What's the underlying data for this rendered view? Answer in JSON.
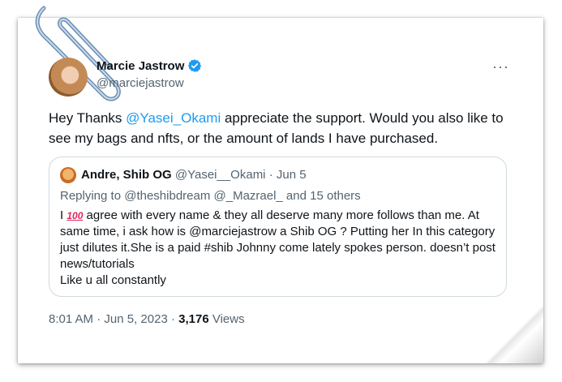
{
  "tweet": {
    "author_name": "Marcie Jastrow",
    "author_handle": "@marciejastrow",
    "more_label": "···",
    "text_before": "Hey Thanks ",
    "mention": "@Yasei_Okami",
    "text_after": " appreciate the support. Would you also like to see my bags and nfts, or the amount of lands I have purchased."
  },
  "quote": {
    "author_name": "Andre, Shib OG",
    "author_handle": "@Yasei__Okami",
    "date_sep": " · ",
    "date": "Jun 5",
    "replying_prefix": "Replying to ",
    "replying_users": "@theshibdream @_Mazrael_",
    "replying_suffix": " and 15 others",
    "text_start": "I ",
    "emoji": "100",
    "text_rest": " agree with every name & they all deserve many more follows than me. At same time, i ask how is @marciejastrow a Shib OG ? Putting her In this category just dilutes it.She is a paid #shib Johnny come lately spokes person. doesn’t post news/tutorials",
    "text_last": "Like u all constantly"
  },
  "footer": {
    "time": "8:01 AM",
    "sep1": " · ",
    "date": "Jun 5, 2023",
    "sep2": " · ",
    "views_count": "3,176",
    "views_label": " Views"
  },
  "colors": {
    "accent": "#1d9bf0",
    "muted": "#536471",
    "text": "#0f1419",
    "border": "#cfd9de"
  }
}
